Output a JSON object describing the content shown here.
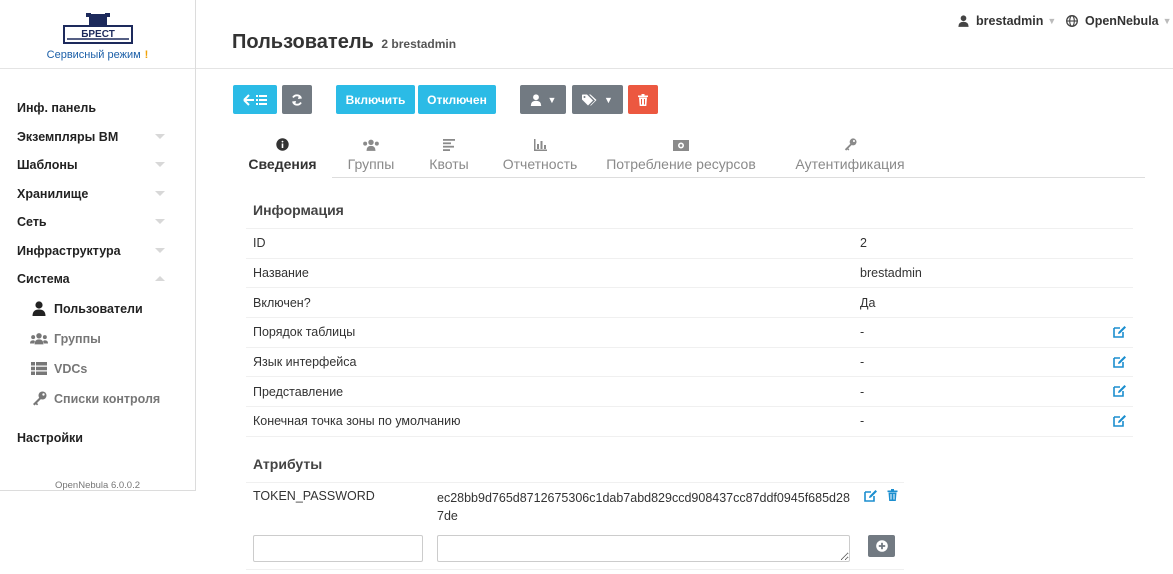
{
  "brand": {
    "service_mode": "Сервисный режим",
    "warn": "!",
    "logo_text": "БРЕСТ"
  },
  "sidebar": {
    "items": [
      {
        "label": "Инф. панель",
        "caret": "none"
      },
      {
        "label": "Экземпляры ВМ",
        "caret": "down"
      },
      {
        "label": "Шаблоны",
        "caret": "down"
      },
      {
        "label": "Хранилище",
        "caret": "down"
      },
      {
        "label": "Сеть",
        "caret": "down"
      },
      {
        "label": "Инфраструктура",
        "caret": "down"
      },
      {
        "label": "Система",
        "caret": "up"
      }
    ],
    "sub_items": [
      {
        "label": "Пользователи",
        "icon": "user-icon",
        "active": true
      },
      {
        "label": "Группы",
        "icon": "users-icon",
        "active": false
      },
      {
        "label": "VDCs",
        "icon": "list-icon",
        "active": false
      },
      {
        "label": "Списки контроля",
        "icon": "key-icon",
        "active": false
      }
    ],
    "settings": "Настройки",
    "version": "OpenNebula 6.0.0.2"
  },
  "header": {
    "title": "Пользователь",
    "subtitle": "2 brestadmin",
    "user": "brestadmin",
    "zone": "OpenNebula"
  },
  "toolbar": {
    "enable": "Включить",
    "disable": "Отключен"
  },
  "tabs": [
    {
      "label": "Сведения",
      "icon": "info-icon"
    },
    {
      "label": "Группы",
      "icon": "users-icon"
    },
    {
      "label": "Квоты",
      "icon": "align-left-icon"
    },
    {
      "label": "Отчетность",
      "icon": "bar-chart-icon"
    },
    {
      "label": "Потребление ресурсов",
      "icon": "money-icon"
    },
    {
      "label": "Аутентификация",
      "icon": "key-icon"
    }
  ],
  "info": {
    "title": "Информация",
    "rows": [
      {
        "key": "ID",
        "value": "2",
        "editable": false
      },
      {
        "key": "Название",
        "value": "brestadmin",
        "editable": false
      },
      {
        "key": "Включен?",
        "value": "Да",
        "editable": false
      },
      {
        "key": "Порядок таблицы",
        "value": "-",
        "editable": true
      },
      {
        "key": "Язык интерфейса",
        "value": "-",
        "editable": true
      },
      {
        "key": "Представление",
        "value": "-",
        "editable": true
      },
      {
        "key": "Конечная точка зоны по умолчанию",
        "value": "-",
        "editable": true
      }
    ]
  },
  "attributes": {
    "title": "Атрибуты",
    "rows": [
      {
        "key": "TOKEN_PASSWORD",
        "value": "ec28bb9d765d8712675306c1dab7abd829ccd908437cc87ddf0945f685d287de"
      }
    ],
    "new_key_value": "",
    "new_value_value": ""
  },
  "colors": {
    "accent": "#2bbbe6",
    "gray_button": "#727a82",
    "danger": "#ec5840",
    "link": "#1b8ecf"
  }
}
